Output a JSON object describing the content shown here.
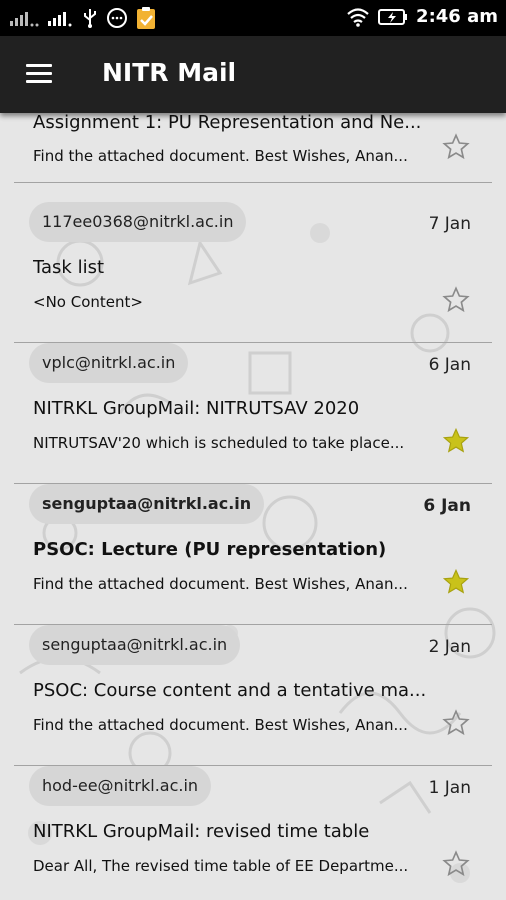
{
  "status_bar": {
    "time": "2:46 am"
  },
  "app_bar": {
    "title": "NITR Mail"
  },
  "emails": [
    {
      "sender": "",
      "date": "",
      "subject": "Assignment 1: PU Representation and Ne...",
      "preview": "Find the attached document. Best Wishes, Anan...",
      "starred": false,
      "unread": false
    },
    {
      "sender": "117ee0368@nitrkl.ac.in",
      "date": "7 Jan",
      "subject": "Task list",
      "preview": "<No Content>",
      "starred": false,
      "unread": false
    },
    {
      "sender": "vplc@nitrkl.ac.in",
      "date": "6 Jan",
      "subject": "NITRKL GroupMail: NITRUTSAV 2020",
      "preview": "NITRUTSAV'20 which is scheduled to take place...",
      "starred": true,
      "unread": false
    },
    {
      "sender": "senguptaa@nitrkl.ac.in",
      "date": "6 Jan",
      "subject": "PSOC: Lecture (PU representation)",
      "preview": "Find the attached document. Best Wishes, Anan...",
      "starred": true,
      "unread": true
    },
    {
      "sender": "senguptaa@nitrkl.ac.in",
      "date": "2 Jan",
      "subject": "PSOC: Course content and a tentative ma...",
      "preview": "Find the attached document. Best Wishes, Anan...",
      "starred": false,
      "unread": false
    },
    {
      "sender": "hod-ee@nitrkl.ac.in",
      "date": "1 Jan",
      "subject": "NITRKL GroupMail: revised time table",
      "preview": "Dear All, The revised time table of EE Departme...",
      "starred": false,
      "unread": false
    }
  ],
  "colors": {
    "star_filled": "#c9c21a",
    "star_outline": "#8a8a8a",
    "app_bar": "#212121",
    "status_bar": "#000000",
    "sender_chip": "#d6d6d6"
  },
  "icons": [
    "signal-icon",
    "usb-icon",
    "chat-icon",
    "clipboard-icon",
    "wifi-icon",
    "battery-charging-icon",
    "menu-icon",
    "star-icon"
  ]
}
